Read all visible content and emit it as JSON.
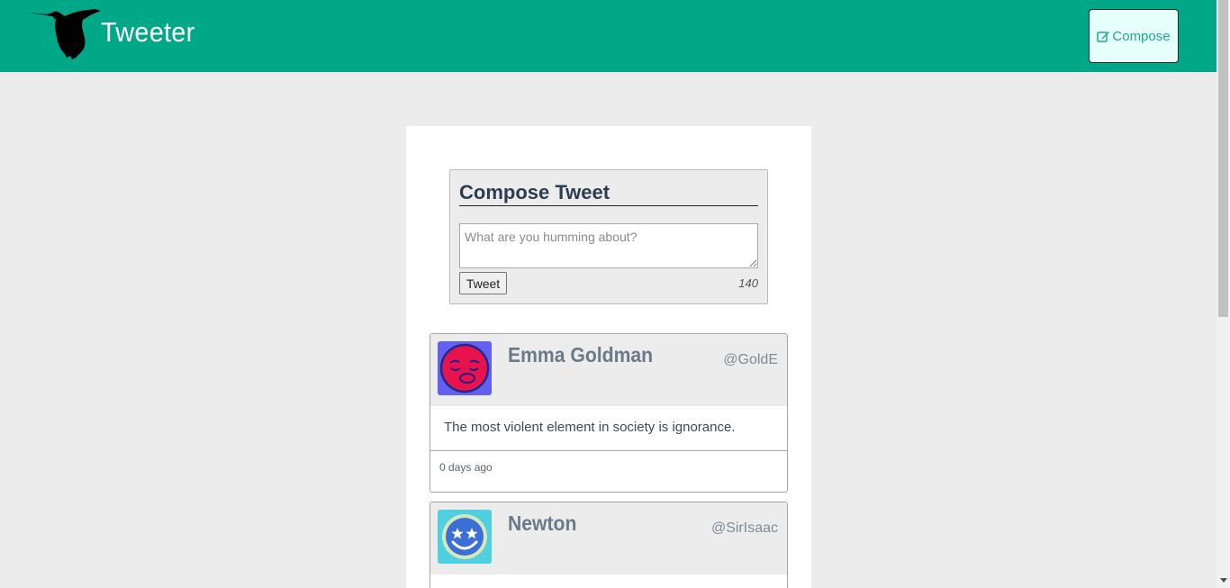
{
  "header": {
    "brand": "Tweeter",
    "compose_label": "Compose"
  },
  "composer": {
    "title": "Compose Tweet",
    "placeholder": "What are you humming about?",
    "submit_label": "Tweet",
    "counter": "140"
  },
  "tweets": [
    {
      "name": "Emma Goldman",
      "handle": "@GoldE",
      "text": "The most violent element in society is ignorance.",
      "time": "0 days ago",
      "avatar_icon": "sleepy-red-face-icon"
    },
    {
      "name": "Newton",
      "handle": "@SirIsaac",
      "text": "",
      "time": "",
      "avatar_icon": "star-eyes-smiley-icon"
    }
  ],
  "colors": {
    "nav": "#00a887",
    "accent": "#1ea98e",
    "background": "#ececec"
  }
}
